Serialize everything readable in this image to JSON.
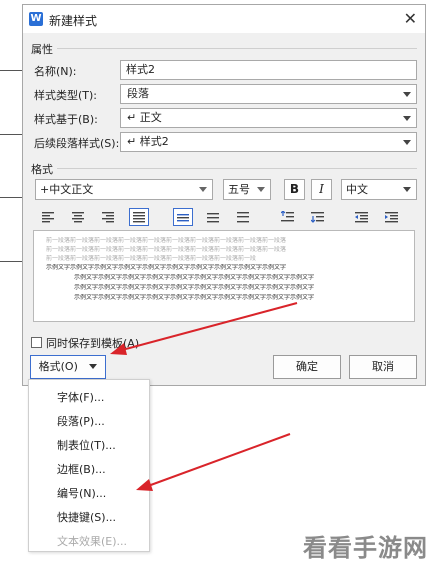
{
  "dialog": {
    "title": "新建样式",
    "app_logo": "W",
    "close_glyph": "✕"
  },
  "properties": {
    "section_label": "属性",
    "name_label": "名称(N):",
    "name_value": "样式2",
    "type_label": "样式类型(T):",
    "type_value": "段落",
    "based_on_label": "样式基于(B):",
    "based_on_value": "↵ 正文",
    "next_label": "后续段落样式(S):",
    "next_value": "↵ 样式2"
  },
  "format": {
    "section_label": "格式",
    "font_value": "+中文正文",
    "size_value": "五号",
    "bold_label": "B",
    "italic_label": "I",
    "lang_value": "中文",
    "toolbar_icons": [
      "align-left-icon",
      "align-center-icon",
      "align-right-icon",
      "align-justify-icon",
      "line-spacing-single-icon",
      "line-spacing-1-5-icon",
      "line-spacing-double-icon",
      "space-before-icon",
      "space-after-icon",
      "indent-decrease-icon",
      "indent-increase-icon"
    ]
  },
  "preview": {
    "prev_text": "前一段落前一段落前一段落前一段落前一段落前一段落前一段落前一段落前一段落前一段落",
    "sample_text": "示例文字示例文字示例文字示例文字示例文字示例文字示例文字示例文字示例文字示例文字"
  },
  "options": {
    "save_to_template_label": "同时保存到模板(A)"
  },
  "buttons": {
    "format_label": "格式(O)",
    "ok_label": "确定",
    "cancel_label": "取消"
  },
  "menu": {
    "items": [
      {
        "label": "字体(F)...",
        "enabled": true
      },
      {
        "label": "段落(P)...",
        "enabled": true
      },
      {
        "label": "制表位(T)...",
        "enabled": true
      },
      {
        "label": "边框(B)...",
        "enabled": true
      },
      {
        "label": "编号(N)...",
        "enabled": true
      },
      {
        "label": "快捷键(S)...",
        "enabled": true
      },
      {
        "label": "文本效果(E)...",
        "enabled": false
      }
    ]
  },
  "annotations": {
    "arrow_color": "#d9242a"
  },
  "watermark": "看看手游网",
  "colors": {
    "accent": "#3c6ecf",
    "dialog_bg": "#f0f0f0",
    "logo": "#2a6fd6"
  }
}
